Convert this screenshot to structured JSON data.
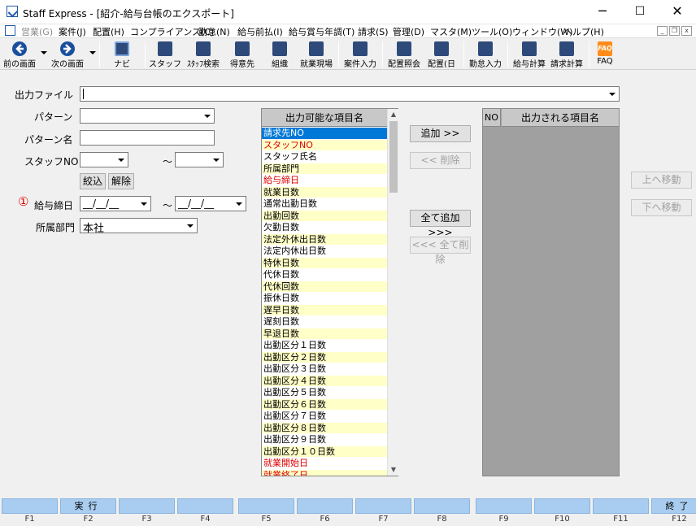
{
  "window": {
    "title": "Staff Express - [紹介-給与台帳のエクスポート]",
    "minimize": "─",
    "maximize": "☐",
    "close": "✕"
  },
  "menu": {
    "items": [
      {
        "label": "営業(G)",
        "disabled": true
      },
      {
        "label": "案件(J)"
      },
      {
        "label": "配置(H)"
      },
      {
        "label": "コンプライアンス(C)"
      },
      {
        "label": "勤怠(N)"
      },
      {
        "label": "給与前払(I)"
      },
      {
        "label": "給与賞与年調(T)"
      },
      {
        "label": "請求(S)"
      },
      {
        "label": "管理(D)"
      },
      {
        "label": "マスタ(M)"
      },
      {
        "label": "ツール(O)"
      },
      {
        "label": "ウィンドウ(W)"
      },
      {
        "label": "ヘルプ(H)"
      }
    ],
    "mdi_min": "_",
    "mdi_restore": "❐",
    "mdi_close": "x"
  },
  "toolbar": {
    "prev": "前の画面",
    "next": "次の画面",
    "navi": "ナビ",
    "staff": "スタッフ",
    "staff_search": "ｽﾀｯﾌ検索",
    "client": "得意先",
    "organization": "組織",
    "worksite": "就業現場",
    "case_entry": "案件入力",
    "placement_inquiry": "配置照会",
    "placement_day": "配置(日",
    "attendance_entry": "勤怠入力",
    "payroll_calc": "給与計算",
    "billing_calc": "請求計算",
    "faq": "FAQ",
    "faq_icon_text": "FAQ"
  },
  "form": {
    "output_file_label": "出力ファイル",
    "output_file_value": "",
    "pattern_label": "パターン",
    "pattern_name_label": "パターン名",
    "staff_no_label": "スタッフNO",
    "range_sep": "～",
    "filter_button": "絞込",
    "clear_button": "解除",
    "marker": "①",
    "pay_close_date_label": "給与締日",
    "date_placeholder": "__/__/__",
    "department_label": "所属部門",
    "department_value": "本社"
  },
  "available": {
    "header": "出力可能な項目名",
    "items": [
      {
        "label": "請求先NO",
        "style": "sel"
      },
      {
        "label": "スタッフNO",
        "style": "alt red"
      },
      {
        "label": "スタッフ氏名",
        "style": "white"
      },
      {
        "label": "所属部門",
        "style": "alt"
      },
      {
        "label": "給与締日",
        "style": "white red"
      },
      {
        "label": "就業日数",
        "style": "alt"
      },
      {
        "label": "通常出勤日数",
        "style": "white"
      },
      {
        "label": "出勤回数",
        "style": "alt"
      },
      {
        "label": "欠勤日数",
        "style": "white"
      },
      {
        "label": "法定外休出日数",
        "style": "alt"
      },
      {
        "label": "法定内休出日数",
        "style": "white"
      },
      {
        "label": "特休日数",
        "style": "alt"
      },
      {
        "label": "代休日数",
        "style": "white"
      },
      {
        "label": "代休回数",
        "style": "alt"
      },
      {
        "label": "振休日数",
        "style": "white"
      },
      {
        "label": "遅早日数",
        "style": "alt"
      },
      {
        "label": "遅刻日数",
        "style": "white"
      },
      {
        "label": "早退日数",
        "style": "alt"
      },
      {
        "label": "出勤区分１日数",
        "style": "white"
      },
      {
        "label": "出勤区分２日数",
        "style": "alt"
      },
      {
        "label": "出勤区分３日数",
        "style": "white"
      },
      {
        "label": "出勤区分４日数",
        "style": "alt"
      },
      {
        "label": "出勤区分５日数",
        "style": "white"
      },
      {
        "label": "出勤区分６日数",
        "style": "alt"
      },
      {
        "label": "出勤区分７日数",
        "style": "white"
      },
      {
        "label": "出勤区分８日数",
        "style": "alt"
      },
      {
        "label": "出勤区分９日数",
        "style": "white"
      },
      {
        "label": "出勤区分１０日数",
        "style": "alt"
      },
      {
        "label": "就業開始日",
        "style": "white red"
      },
      {
        "label": "就業終了日",
        "style": "alt red"
      }
    ]
  },
  "actions": {
    "add": "追加 >>",
    "remove": "<< 削除",
    "add_all": "全て追加 >>>",
    "remove_all": "<<< 全て削除",
    "move_up": "上へ移動",
    "move_down": "下へ移動"
  },
  "output": {
    "no_header": "NO",
    "name_header": "出力される項目名"
  },
  "fkeys": [
    {
      "key": "F1",
      "label": ""
    },
    {
      "key": "F2",
      "label": "実行"
    },
    {
      "key": "F3",
      "label": ""
    },
    {
      "key": "F4",
      "label": ""
    },
    {
      "key": "F5",
      "label": ""
    },
    {
      "key": "F6",
      "label": ""
    },
    {
      "key": "F7",
      "label": ""
    },
    {
      "key": "F8",
      "label": ""
    },
    {
      "key": "F9",
      "label": ""
    },
    {
      "key": "F10",
      "label": ""
    },
    {
      "key": "F11",
      "label": ""
    },
    {
      "key": "F12",
      "label": "終了"
    }
  ],
  "colors": {
    "fkey_blue": "#a9cdf0",
    "list_yellow": "#ffffc8",
    "selection_blue": "#0078d7",
    "required_red": "#e00000",
    "toolbar_icon": "#1a4f9c"
  }
}
